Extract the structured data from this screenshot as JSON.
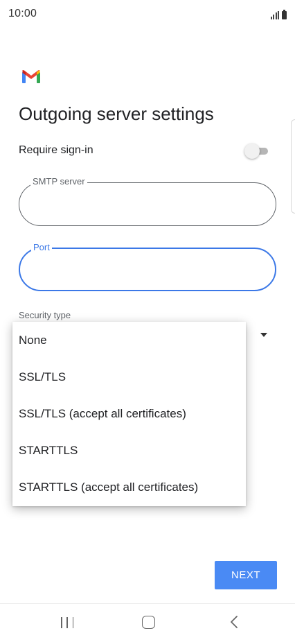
{
  "status_bar": {
    "time": "10:00"
  },
  "header": {
    "logo": "gmail-logo",
    "title": "Outgoing server settings"
  },
  "require_signin": {
    "label": "Require sign-in",
    "enabled": false
  },
  "smtp_server": {
    "label": "SMTP server",
    "value": ""
  },
  "port": {
    "label": "Port",
    "value": "",
    "focused": true
  },
  "security_type": {
    "label": "Security type",
    "options": [
      "None",
      "SSL/TLS",
      "SSL/TLS (accept all certificates)",
      "STARTTLS",
      "STARTTLS (accept all certificates)"
    ]
  },
  "actions": {
    "next_label": "NEXT"
  },
  "navigation": {
    "icons": [
      "recents-icon",
      "home-icon",
      "back-icon"
    ]
  },
  "colors": {
    "accent": "#3b78e7",
    "button": "#4a8af4"
  }
}
